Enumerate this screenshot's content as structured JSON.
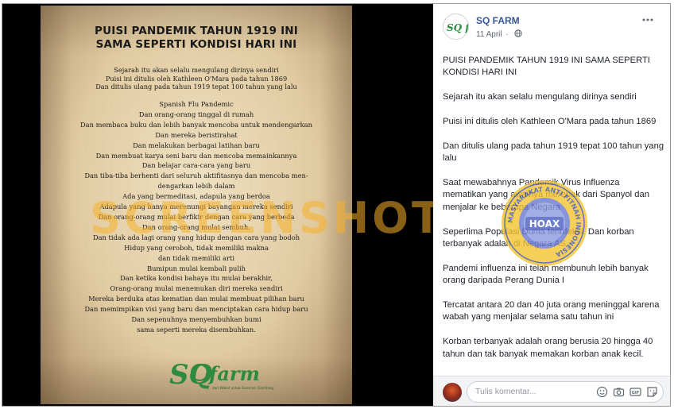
{
  "poster": {
    "title_line1": "PUISI PANDEMIK TAHUN 1919 INI",
    "title_line2": "SAMA SEPERTI KONDISI HARI INI",
    "intro": [
      "Sejarah itu akan selalu mengulang dirinya sendiri",
      "Puisi ini ditulis oleh Kathleen O'Mara pada tahun 1869",
      "Dan ditulis ulang pada tahun 1919 tepat 100 tahun yang lalu"
    ],
    "poem": [
      "Spanish Flu Pandemic",
      "Dan orang-orang tinggal di rumah",
      "Dan membaca buku dan lebih banyak mencoba untuk mendengarkan",
      "Dan mereka beristirahat",
      "Dan melakukan berbagai latihan baru",
      "Dan membuat karya seni baru dan mencoba memainkannya",
      "Dan belajar cara-cara yang baru",
      "Dan tiba-tiba berhenti dari seluruh aktifitasnya dan mencoba men-",
      "dengarkan lebih dalam",
      "Ada yang bermeditasi, adapula yang berdoa",
      "Adapula yang hanya merenungi bayangan mereka sendiri",
      "Dan orang-orang mulai berfikir dengan cara yang berbeda",
      "Dan orang-orang mulai sembuh.",
      "Dan tidak ada lagi orang yang hidup dengan cara yang bodoh",
      "Hidup yang ceroboh, tidak memiliki makna",
      "dan tidak memiliki arti",
      "Bumipun mulai kembali pulih",
      "Dan ketika kondisi bahaya itu mulai berakhir,",
      "Orang-orang mulai menemukan diri mereka sendiri",
      "Mereka berduka atas kematian dan mulai membuat pilihan baru",
      "Dan memimpikan visi yang baru dan menciptakan cara hidup baru",
      "Dan sepenuhnya menyembuhkan bumi",
      "sama seperti mereka disembuhkan."
    ],
    "logo_text": "farm",
    "logo_letters": "SQ",
    "logo_tagline": "dari Wakaf untuk Generasi Gemilang"
  },
  "watermark_text": "SCREENSHOT BY",
  "stamp": {
    "ring_text": "MASYARAKAT ANTI FITNAH INDONESIA",
    "center_text": "HOAX"
  },
  "post": {
    "page_name": "SQ FARM",
    "date": "11 April",
    "separator": "·",
    "avatar_label": "SQ farm",
    "paragraphs": [
      "PUISI PANDEMIK TAHUN 1919 INI SAMA SEPERTI KONDISI HARI INI",
      "Sejarah itu akan selalu mengulang dirinya sendiri",
      "Puisi ini ditulis oleh Kathleen O'Mara pada tahun 1869",
      "Dan ditulis ulang pada tahun 1919 tepat 100 tahun yang lalu",
      "Saat mewabahnya Pandemik Virus Influenza mematikan yang awalnya merebak dari Spanyol dan menjalar ke beberapa Negara",
      "Seperlima Populasi Dunia terinfeksi. Dan korban terbanyak adalah di Negara AS",
      "Pandemi influenza ini telah membunuh lebih banyak orang daripada Perang Dunia I",
      "Tercatat antara 20 dan 40 juta orang meninggal karena wabah yang menjalar selama satu tahun ini",
      "Korban terbanyak adalah orang berusia 20 hingga 40 tahun dan tak banyak memakan korban anak kecil."
    ]
  },
  "comment": {
    "placeholder": "Tulis komentar...",
    "icons": [
      "emoji-icon",
      "camera-icon",
      "gif-icon",
      "sticker-icon"
    ]
  },
  "colors": {
    "fb_link": "#385898",
    "watermark": "#f8b028",
    "stamp_blue": "#3a4fb0",
    "stamp_yellow": "#f4c430",
    "logo_green": "#2e8b3e"
  }
}
